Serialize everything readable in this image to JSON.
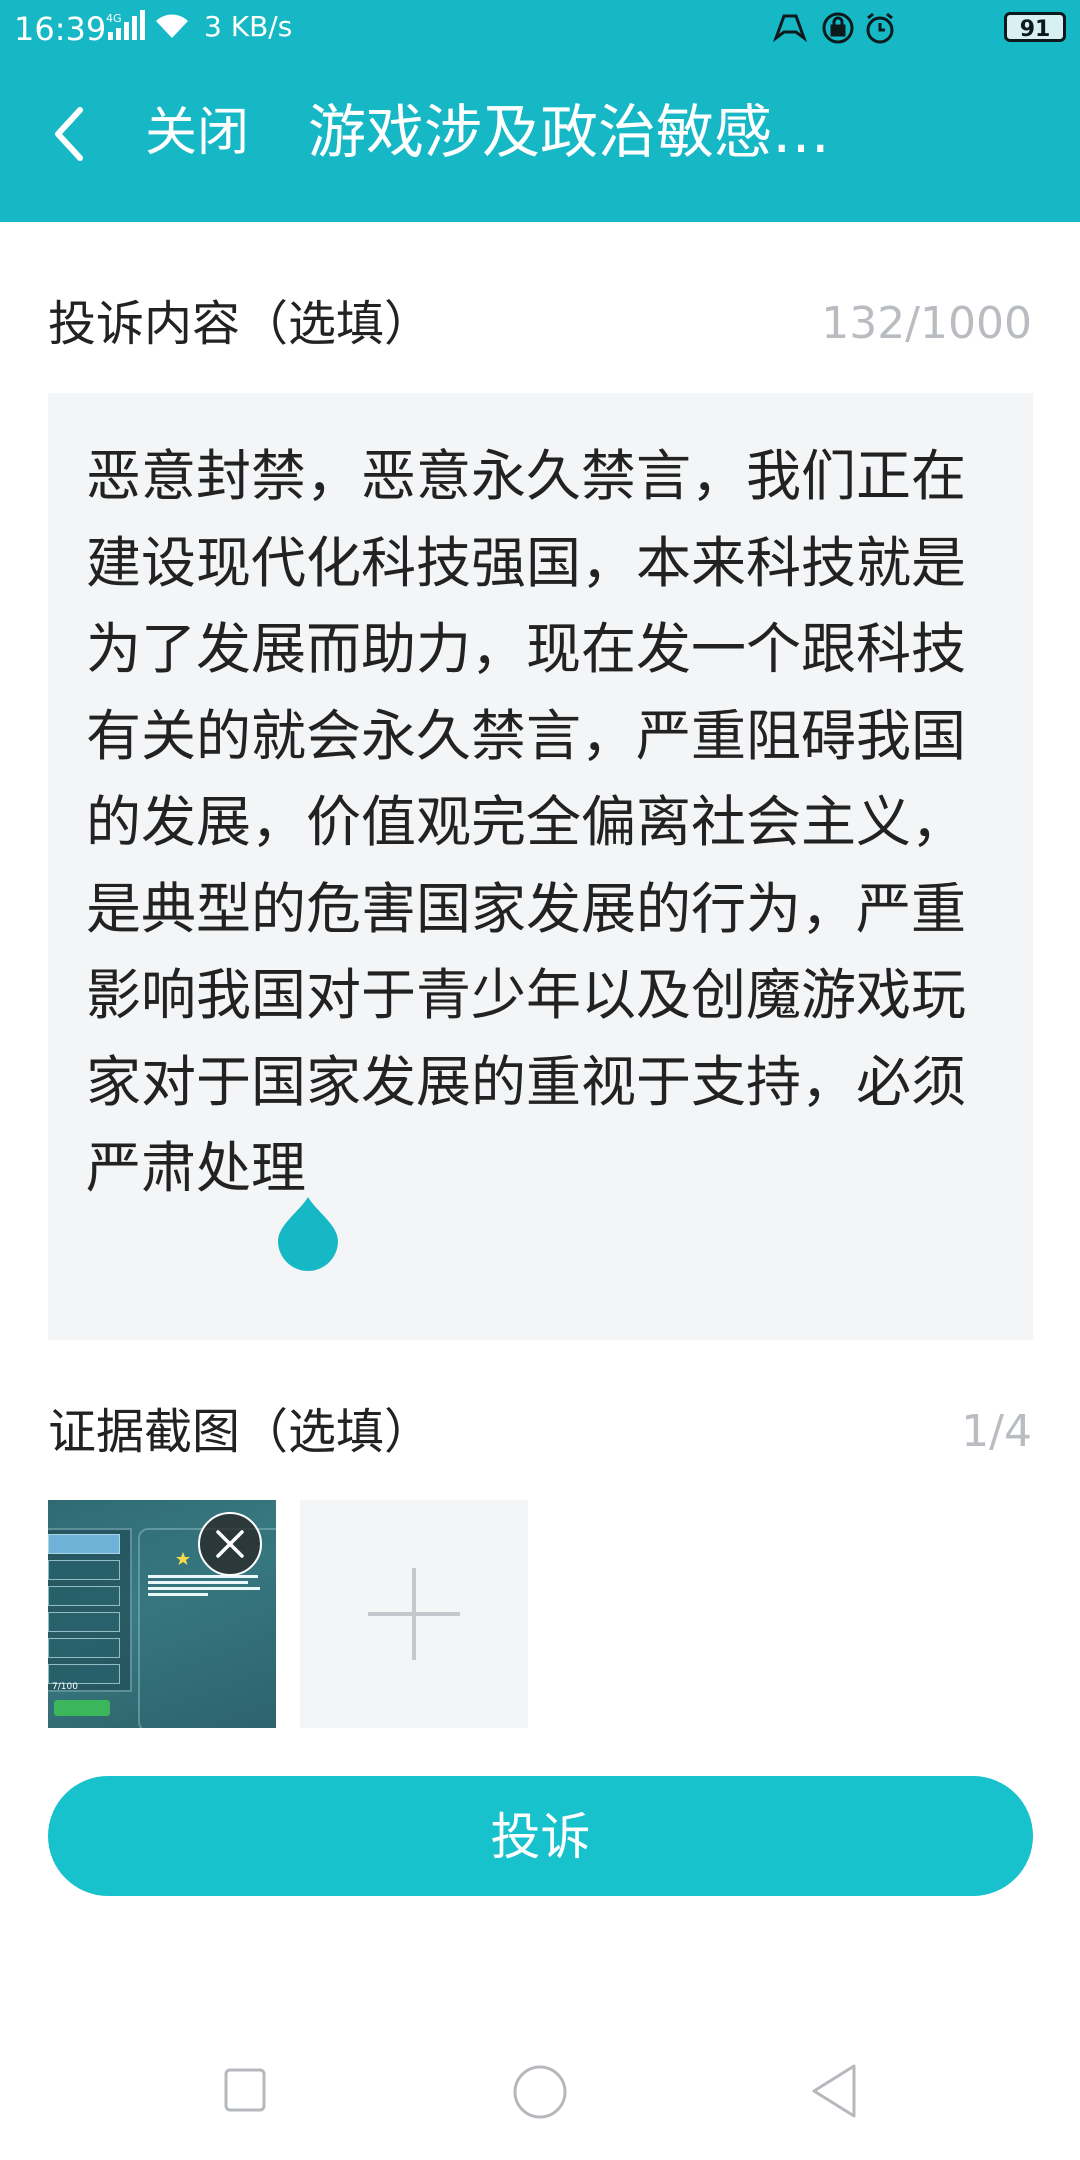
{
  "status_bar": {
    "time": "16:39",
    "network": "4G",
    "speed": "3 KB/s",
    "battery": "91"
  },
  "header": {
    "close_label": "关闭",
    "title": "游戏涉及政治敏感…"
  },
  "complaint": {
    "label": "投诉内容（选填）",
    "counter": "132/1000",
    "text": "恶意封禁，恶意永久禁言，我们正在建设现代化科技强国，本来科技就是为了发展而助力，现在发一个跟科技有关的就会永久禁言，严重阻碍我国的发展，价值观完全偏离社会主义，是典型的危害国家发展的行为，严重影响我国对于青少年以及创魔游戏玩家对于国家发展的重视于支持，必须严肃处理"
  },
  "evidence": {
    "label": "证据截图（选填）",
    "counter": "1/4",
    "thumbnail": {
      "count": "7/100"
    }
  },
  "submit_label": "投诉",
  "colors": {
    "header": "#17b8c6",
    "button": "#17c2cc",
    "input_bg": "#f4f5f7",
    "counter_text": "#b9bcc0"
  },
  "icons": {
    "back": "chevron-left-icon",
    "remove": "close-icon",
    "add": "plus-icon",
    "cursor": "text-cursor-handle-icon"
  }
}
